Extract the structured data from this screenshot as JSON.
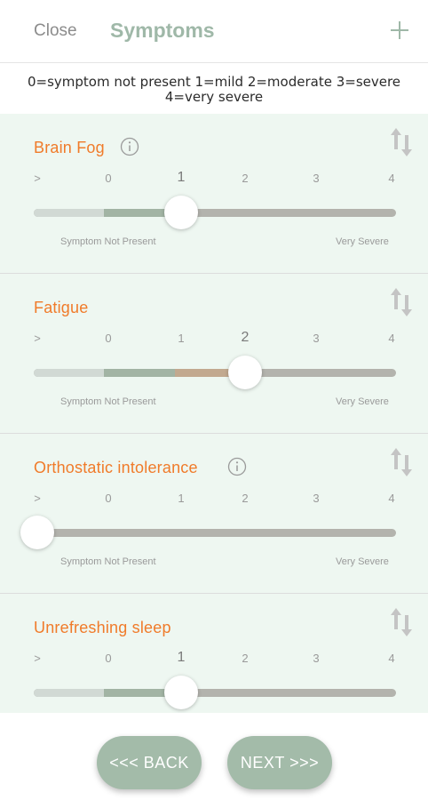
{
  "header": {
    "close_label": "Close",
    "title": "Symptoms",
    "add_icon": "plus-icon"
  },
  "legend": {
    "line1": "0=symptom not present 1=mild 2=moderate 3=severe",
    "line2": "4=very severe"
  },
  "scale": {
    "ticks": [
      ">",
      "0",
      "1",
      "2",
      "3",
      "4"
    ],
    "min_label": "Symptom Not Present",
    "max_label": "Very Severe"
  },
  "colors": {
    "accent": "#f07b2a",
    "brand_green": "#9fb8a8",
    "panel": "#eef7f1",
    "track": "#b3b3ad"
  },
  "symptoms": [
    {
      "name": "Brain Fog",
      "info": true,
      "value": 1
    },
    {
      "name": "Fatigue",
      "info": false,
      "value": 2
    },
    {
      "name": "Orthostatic intolerance",
      "info": true,
      "value": -1
    },
    {
      "name": "Unrefreshing sleep",
      "info": false,
      "value": 1
    }
  ],
  "footer": {
    "back_label": "<<< BACK",
    "next_label": "NEXT >>>"
  }
}
